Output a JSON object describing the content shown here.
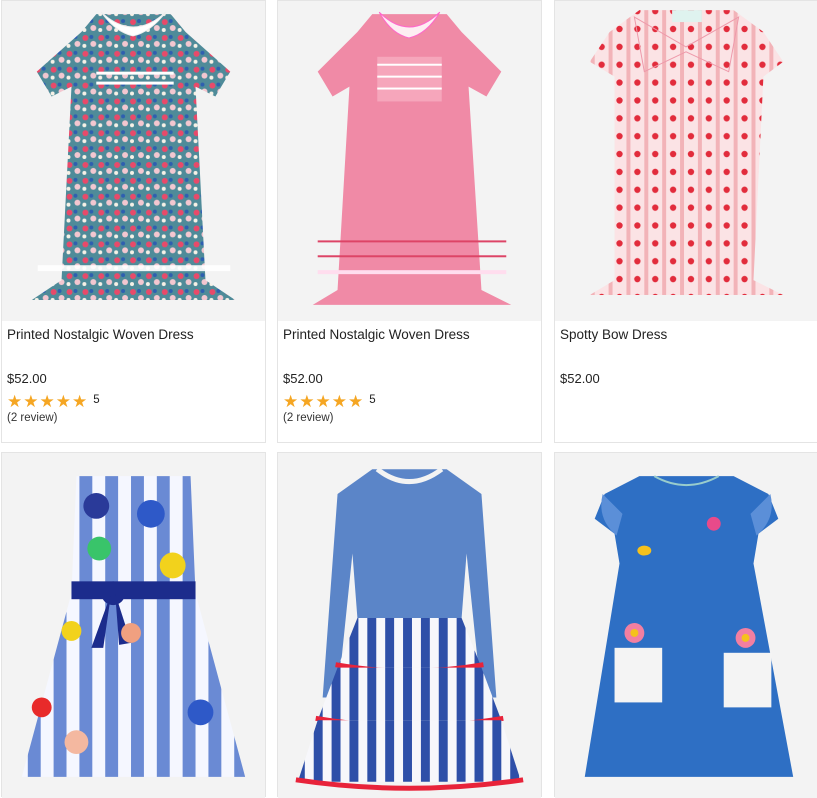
{
  "products": [
    {
      "title": "Printed Nostalgic Woven Dress",
      "price": "$52.00",
      "stars": "★★★★★",
      "rating": "5",
      "reviews": "(2 review)",
      "colors": {
        "body": "#5a8a9a",
        "accent": "#e9506a"
      }
    },
    {
      "title": "Printed Nostalgic Woven Dress",
      "price": "$52.00",
      "stars": "★★★★★",
      "rating": "5",
      "reviews": "(2 review)",
      "colors": {
        "body": "#f08aa6",
        "accent": "#fdd"
      }
    },
    {
      "title": "Spotty Bow Dress",
      "price": "$52.00",
      "colors": {
        "body": "#fbe3e5",
        "accent": "#e22c3c"
      }
    },
    {
      "colors": {
        "body": "#5d7ec8",
        "accent": "#ffffff"
      }
    },
    {
      "colors": {
        "body": "#5b85c8",
        "accent": "#e8233a"
      }
    },
    {
      "colors": {
        "body": "#2e6fc4",
        "accent": "#f06090"
      }
    }
  ]
}
